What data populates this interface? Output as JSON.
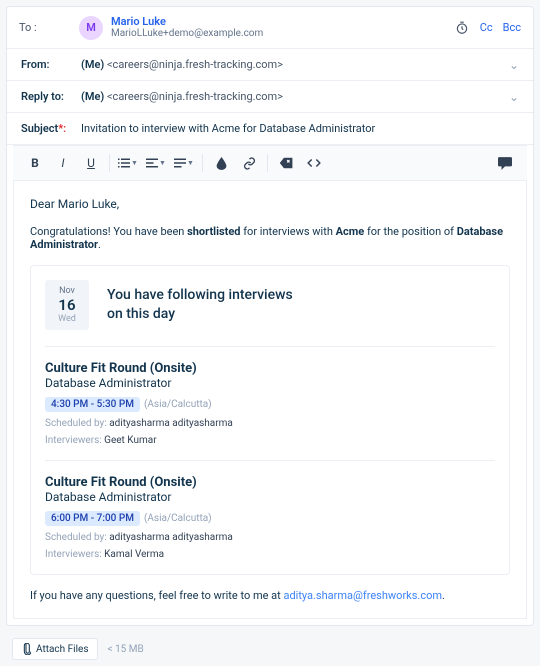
{
  "to": {
    "label": "To  :",
    "initial": "M",
    "name": "Mario Luke",
    "email": "MarioLLuke+demo@example.com",
    "cc": "Cc",
    "bcc": "Bcc"
  },
  "from": {
    "label": "From:",
    "me": "(Me) ",
    "value": "<careers@ninja.fresh-tracking.com>"
  },
  "replyTo": {
    "label": "Reply to:",
    "me": "(Me) ",
    "value": "<careers@ninja.fresh-tracking.com>"
  },
  "subject": {
    "label": "Subject",
    "req": "*:",
    "value": "Invitation to interview with Acme for Database Administrator"
  },
  "body": {
    "greeting": "Dear Mario Luke,",
    "congrats_a": "Congratulations! You have been ",
    "congrats_b": "shortlisted",
    "congrats_c": " for interviews with ",
    "congrats_d": "Acme",
    "congrats_e": " for the position of ",
    "congrats_f": "Database Administrator",
    "congrats_g": ".",
    "date": {
      "month": "Nov",
      "day": "16",
      "weekday": "Wed"
    },
    "headline_a": "You have following interviews",
    "headline_b": "on this day",
    "interviews": [
      {
        "title": "Culture Fit Round (Onsite)",
        "role": "Database Administrator",
        "time": "4:30 PM - 5:30 PM",
        "tz": "(Asia/Calcutta)",
        "sched_label": "Scheduled by: ",
        "sched_val": "adityasharma adityasharma",
        "int_label": "Interviewers: ",
        "int_val": "Geet Kumar"
      },
      {
        "title": "Culture Fit Round (Onsite)",
        "role": "Database Administrator",
        "time": "6:00 PM - 7:00 PM",
        "tz": "(Asia/Calcutta)",
        "sched_label": "Scheduled by: ",
        "sched_val": "adityasharma adityasharma",
        "int_label": "Interviewers: ",
        "int_val": "Kamal Verma"
      }
    ],
    "questions_a": "If you have any questions, feel free to write to me at ",
    "questions_link": "aditya.sharma@freshworks.com",
    "questions_b": "."
  },
  "attach": {
    "label": "Attach Files",
    "hint": "< 15 MB"
  }
}
